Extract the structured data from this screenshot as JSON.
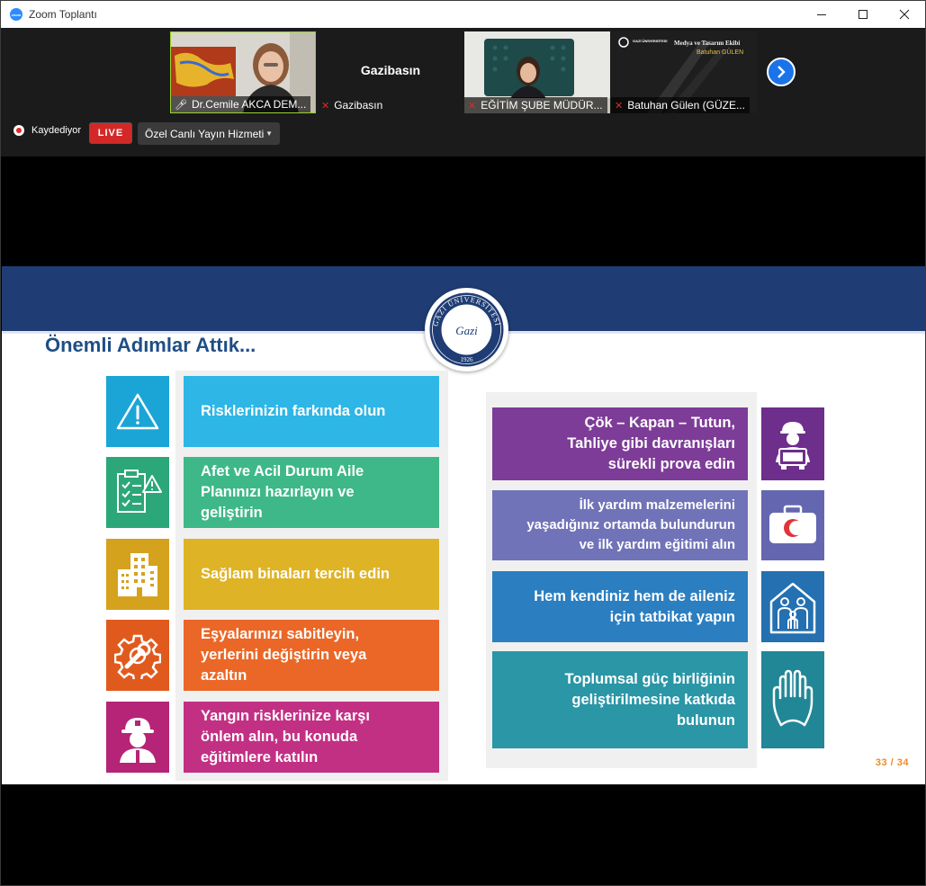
{
  "window": {
    "title": "Zoom Toplantı",
    "app_icon_text": "zoom"
  },
  "gallery": {
    "tiles": [
      {
        "name": "Dr.Cemile AKCA DEM...",
        "muted": false
      },
      {
        "name": "Gazibasın",
        "muted": true,
        "display_name": "Gazibasın"
      },
      {
        "name": "EĞİTİM ŞUBE MÜDÜR...",
        "muted": true
      },
      {
        "name": "Batuhan Gülen (GÜZE...",
        "muted": true,
        "video_text": {
          "line1": "Medya ve Tasarım Ekibi",
          "line2": "Batuhan GÜLEN",
          "logo_text": "GAZİ ÜNİVERSİTESİ"
        }
      }
    ],
    "next_icon": "chevron-right-icon"
  },
  "recording": {
    "label": "Kaydediyor",
    "live_badge": "LIVE",
    "stream_service": "Özel Canlı Yayın Hizmeti"
  },
  "slide": {
    "title": "Önemli Adımlar Attık...",
    "logo": {
      "text": "GAZİ ÜNİVERSİTESİ",
      "year": "1926",
      "signature": "Gazi"
    },
    "left_items": [
      {
        "text": "Risklerinizin farkında olun",
        "icon": "warning-icon",
        "color": "#2eb6e6",
        "icon_color": "#1ba5d6"
      },
      {
        "text": "Afet ve Acil Durum Aile\nPlanınızı hazırlayın ve\ngeliştirin",
        "icon": "checklist-icon",
        "color": "#3eb889",
        "icon_color": "#2ca779"
      },
      {
        "text": "Sağlam binaları tercih edin",
        "icon": "building-icon",
        "color": "#dfb326",
        "icon_color": "#d5a21d"
      },
      {
        "text": "Eşyalarınızı sabitleyin,\nyerlerini değiştirin veya\nazaltın",
        "icon": "gear-wrench-icon",
        "color": "#ea6727",
        "icon_color": "#e15a1d"
      },
      {
        "text": "Yangın risklerinize karşı\nönlem alın, bu konuda\neğitimlere katılın",
        "icon": "firefighter-icon",
        "color": "#c23084",
        "icon_color": "#b52476"
      }
    ],
    "right_items": [
      {
        "text": "Çök – Kapan – Tutun,\nTahliye gibi davranışları\nsürekli prova edin",
        "icon": "person-covering-icon",
        "color": "#7d3c97",
        "icon_color": "#6d2e8c"
      },
      {
        "text": "İlk yardım malzemelerini\nyaşadığınız ortamda bulundurun\nve ilk yardım eğitimi alın",
        "icon": "first-aid-kit-icon",
        "color": "#7173b9",
        "icon_color": "#6467b0"
      },
      {
        "text": "Hem kendiniz hem de aileniz\niçin tatbikat yapın",
        "icon": "family-house-icon",
        "color": "#2b7ec0",
        "icon_color": "#2470b1"
      },
      {
        "text": "Toplumsal güç birliğinin\ngeliştirilmesine katkıda\nbulunun",
        "icon": "hands-icon",
        "color": "#2a96a6",
        "icon_color": "#218796"
      }
    ],
    "page": "33 / 34"
  }
}
